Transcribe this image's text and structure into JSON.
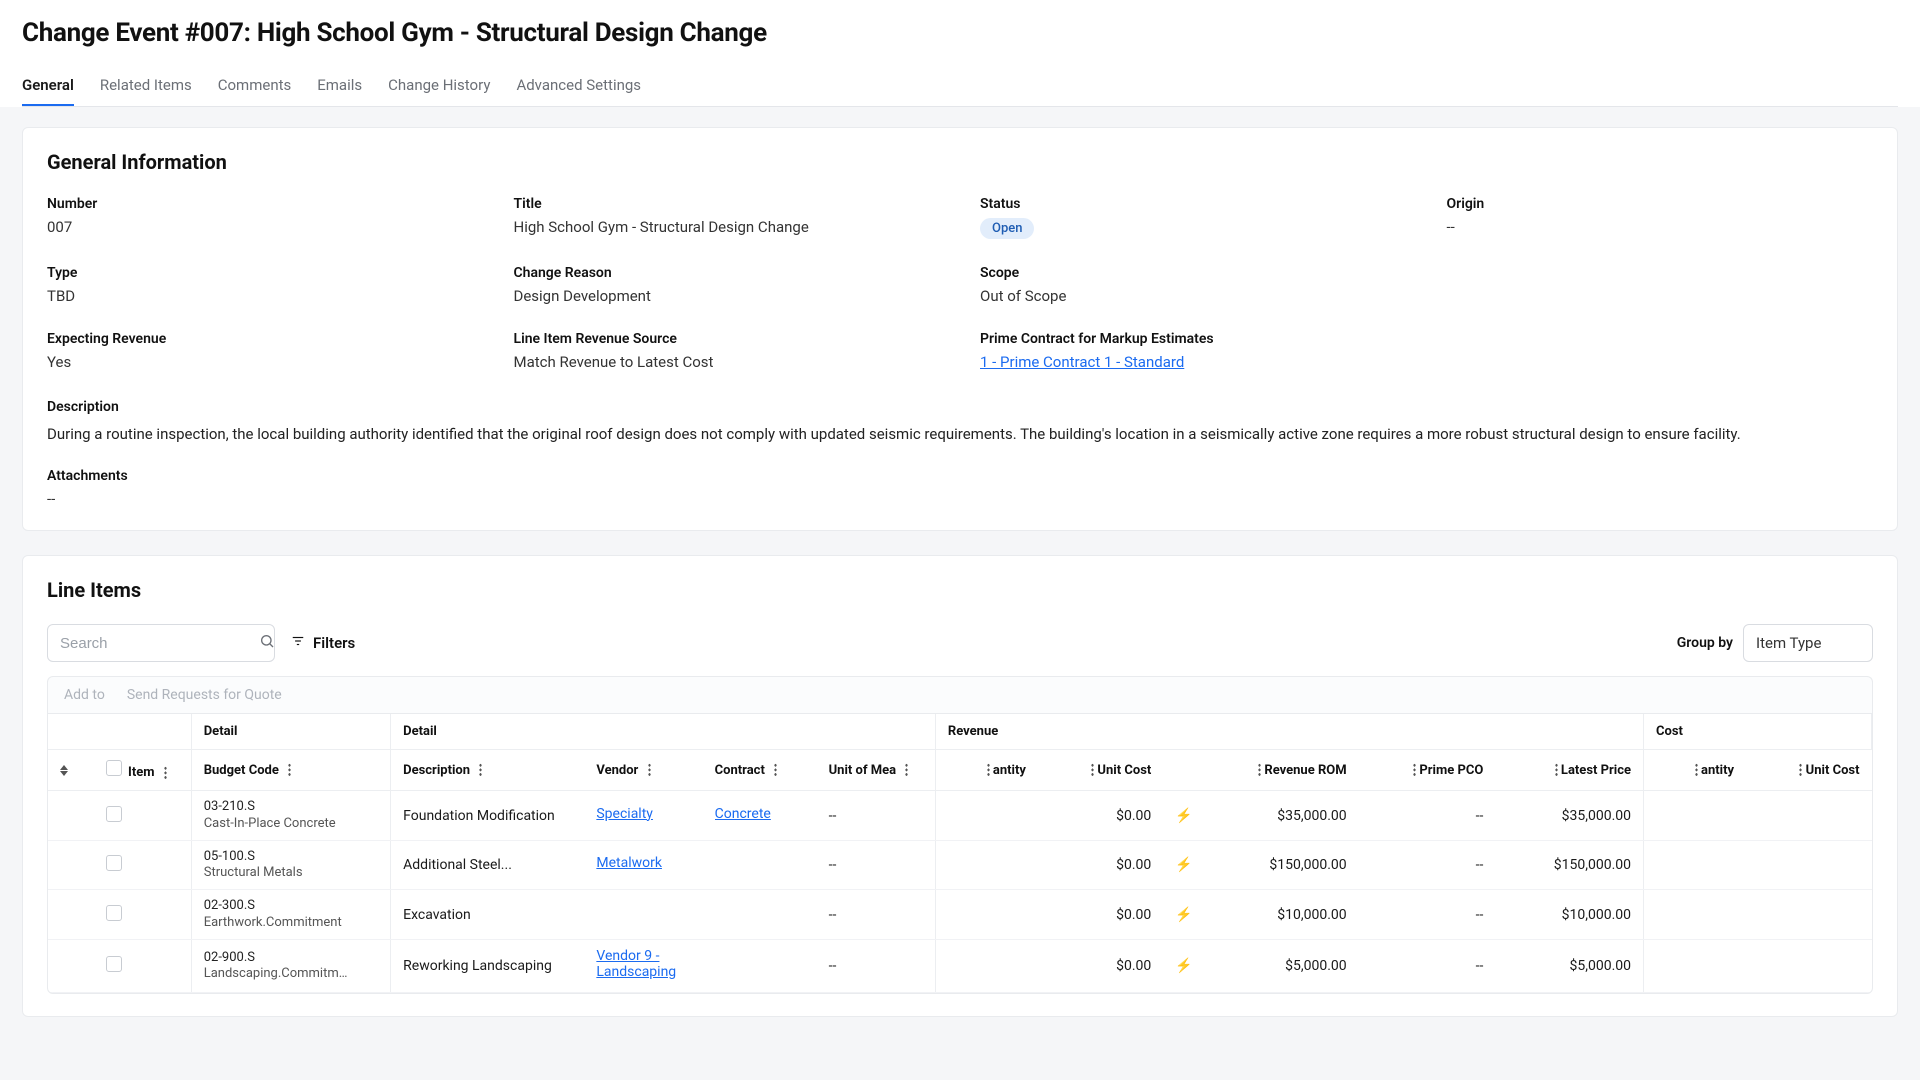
{
  "header": {
    "title": "Change Event #007: High School Gym - Structural Design Change"
  },
  "tabs": [
    {
      "label": "General",
      "active": true
    },
    {
      "label": "Related Items",
      "active": false
    },
    {
      "label": "Comments",
      "active": false
    },
    {
      "label": "Emails",
      "active": false
    },
    {
      "label": "Change History",
      "active": false
    },
    {
      "label": "Advanced Settings",
      "active": false
    }
  ],
  "general_info": {
    "title": "General Information",
    "fields": {
      "number_label": "Number",
      "number_value": "007",
      "title_label": "Title",
      "title_value": "High School Gym - Structural Design Change",
      "status_label": "Status",
      "status_value": "Open",
      "origin_label": "Origin",
      "origin_value": "--",
      "type_label": "Type",
      "type_value": "TBD",
      "change_reason_label": "Change Reason",
      "change_reason_value": "Design Development",
      "scope_label": "Scope",
      "scope_value": "Out of Scope",
      "expecting_rev_label": "Expecting Revenue",
      "expecting_rev_value": "Yes",
      "liirs_label": "Line Item Revenue Source",
      "liirs_value": "Match Revenue to Latest Cost",
      "prime_label": "Prime Contract for Markup Estimates",
      "prime_value": "1 - Prime Contract 1 - Standard"
    },
    "description_label": "Description",
    "description_text": "During a routine inspection, the local building authority identified that the original roof design does not comply with updated seismic requirements. The building's location in a seismically active zone requires a more robust structural design to ensure facility.",
    "attachments_label": "Attachments",
    "attachments_value": "--"
  },
  "line_items": {
    "title": "Line Items",
    "search_placeholder": "Search",
    "filters_label": "Filters",
    "groupby_label": "Group by",
    "groupby_value": "Item Type",
    "action_add": "Add to",
    "action_srq": "Send Requests for Quote",
    "groups": {
      "detail1": "Detail",
      "detail2": "Detail",
      "revenue": "Revenue",
      "cost": "Cost"
    },
    "columns": {
      "item": "Item",
      "budget_code": "Budget Code",
      "description": "Description",
      "vendor": "Vendor",
      "contract": "Contract",
      "uom": "Unit of Mea",
      "quantity": "antity",
      "unit_cost": "Unit Cost",
      "revenue_rom": "Revenue ROM",
      "prime_pco": "Prime PCO",
      "latest_price": "Latest Price",
      "cost_quantity": "antity",
      "cost_unit_cost": "Unit Cost"
    },
    "rows": [
      {
        "bc_code": "03-210.S",
        "bc_sub": "Cast-In-Place Concrete",
        "desc": "Foundation Modification",
        "vendor": "Specialty",
        "contract": "Concrete",
        "uom": "--",
        "unit_cost": "$0.00",
        "revenue_rom": "$35,000.00",
        "prime_pco": "--",
        "latest_price": "$35,000.00"
      },
      {
        "bc_code": "05-100.S",
        "bc_sub": "Structural Metals",
        "desc": "Additional Steel...",
        "vendor": "Metalwork",
        "contract": "",
        "uom": "--",
        "unit_cost": "$0.00",
        "revenue_rom": "$150,000.00",
        "prime_pco": "--",
        "latest_price": "$150,000.00"
      },
      {
        "bc_code": "02-300.S",
        "bc_sub": "Earthwork.Commitment",
        "desc": "Excavation",
        "vendor": "",
        "contract": "",
        "uom": "--",
        "unit_cost": "$0.00",
        "revenue_rom": "$10,000.00",
        "prime_pco": "--",
        "latest_price": "$10,000.00"
      },
      {
        "bc_code": "02-900.S",
        "bc_sub": "Landscaping.Commitment",
        "desc": "Reworking Landscaping",
        "vendor": "Vendor 9 - Landscaping",
        "contract": "",
        "uom": "--",
        "unit_cost": "$0.00",
        "revenue_rom": "$5,000.00",
        "prime_pco": "--",
        "latest_price": "$5,000.00"
      }
    ]
  }
}
